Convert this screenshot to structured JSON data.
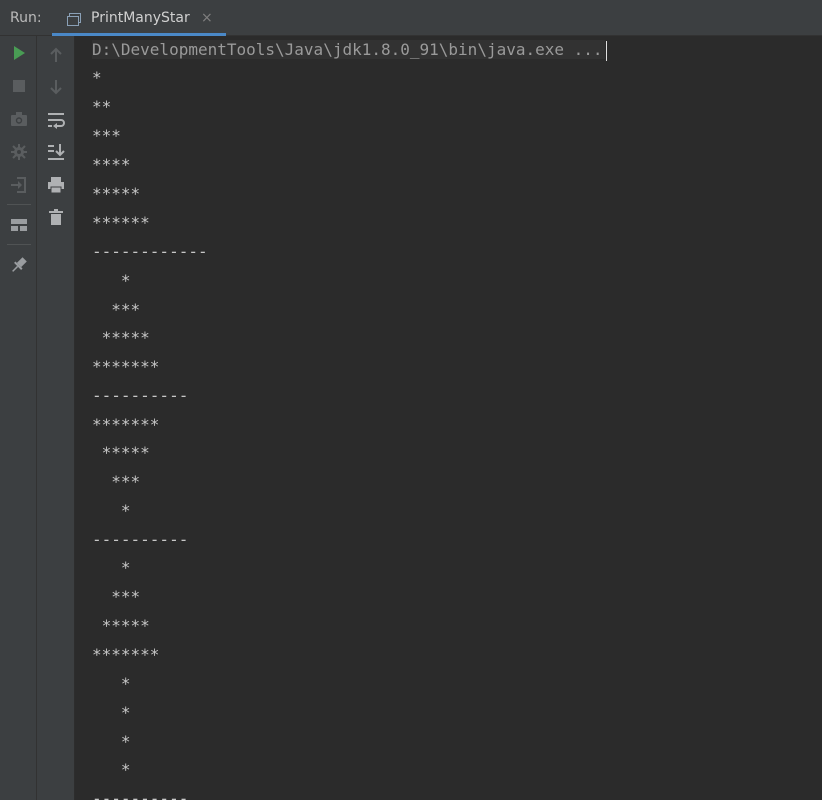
{
  "header": {
    "run_label": "Run:",
    "tab_title": "PrintManyStar",
    "tab_close": "×"
  },
  "colors": {
    "background": "#2b2b2b",
    "toolbar": "#3c3f41",
    "tab_underline": "#4a88c7",
    "run_green": "#499c54"
  },
  "left_toolbar": [
    {
      "name": "rerun-icon"
    },
    {
      "name": "stop-icon"
    },
    {
      "name": "camera-icon"
    },
    {
      "name": "settings-bug-icon"
    },
    {
      "name": "exit-icon"
    },
    {
      "name": "layout-icon"
    },
    {
      "name": "pin-icon"
    }
  ],
  "right_toolbar": [
    {
      "name": "up-arrow-icon"
    },
    {
      "name": "down-arrow-icon"
    },
    {
      "name": "soft-wrap-icon"
    },
    {
      "name": "scroll-to-end-icon"
    },
    {
      "name": "print-icon"
    },
    {
      "name": "trash-icon"
    }
  ],
  "console": {
    "command": "D:\\DevelopmentTools\\Java\\jdk1.8.0_91\\bin\\java.exe ...",
    "lines": [
      "*",
      "**",
      "***",
      "****",
      "*****",
      "******",
      "------------",
      "   *",
      "  ***",
      " *****",
      "*******",
      "----------",
      "*******",
      " *****",
      "  ***",
      "   *",
      "----------",
      "   *",
      "  ***",
      " *****",
      "*******",
      "   *",
      "   *",
      "   *",
      "   *",
      "----------"
    ]
  }
}
